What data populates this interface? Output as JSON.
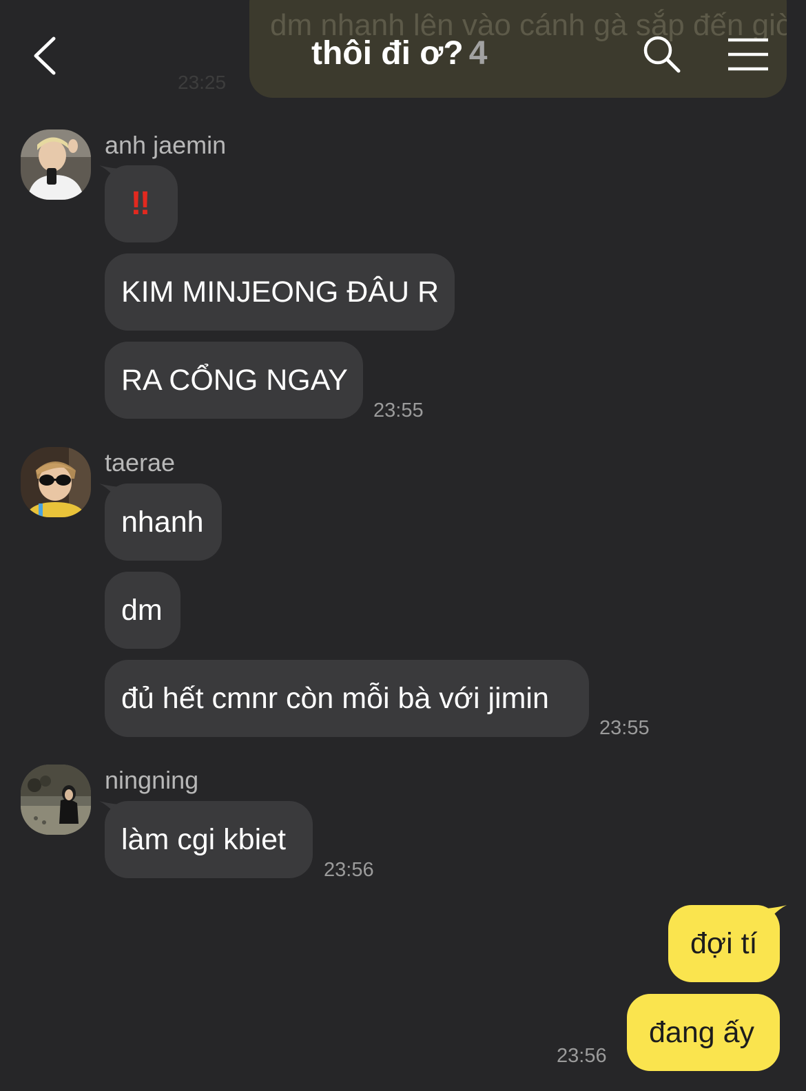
{
  "header": {
    "title": "thôi đi ơ?",
    "member_count": "4",
    "icons": [
      "chevron-left-icon",
      "search-icon",
      "menu-icon"
    ]
  },
  "previous_message": {
    "text": "dm nhanh lên vào cánh gà sắp đến giờ",
    "time": "23:25"
  },
  "groups": [
    {
      "sender": "anh jaemin",
      "messages": [
        "‼",
        "KIM MINJEONG ĐÂU R",
        "RA CỔNG NGAY"
      ],
      "time": "23:55"
    },
    {
      "sender": "taerae",
      "messages": [
        "nhanh",
        "dm",
        "đủ hết cmnr còn mỗi bà với jimin"
      ],
      "time": "23:55"
    },
    {
      "sender": "ningning",
      "messages": [
        "làm cgi kbiet"
      ],
      "time": "23:56"
    }
  ],
  "my_messages": {
    "messages": [
      "đợi tí",
      "đang ấy"
    ],
    "time": "23:56"
  },
  "colors": {
    "background": "#262628",
    "incoming_bubble": "#3a3a3c",
    "outgoing_bubble": "#fae44e",
    "emoji_red": "#e2291f"
  }
}
